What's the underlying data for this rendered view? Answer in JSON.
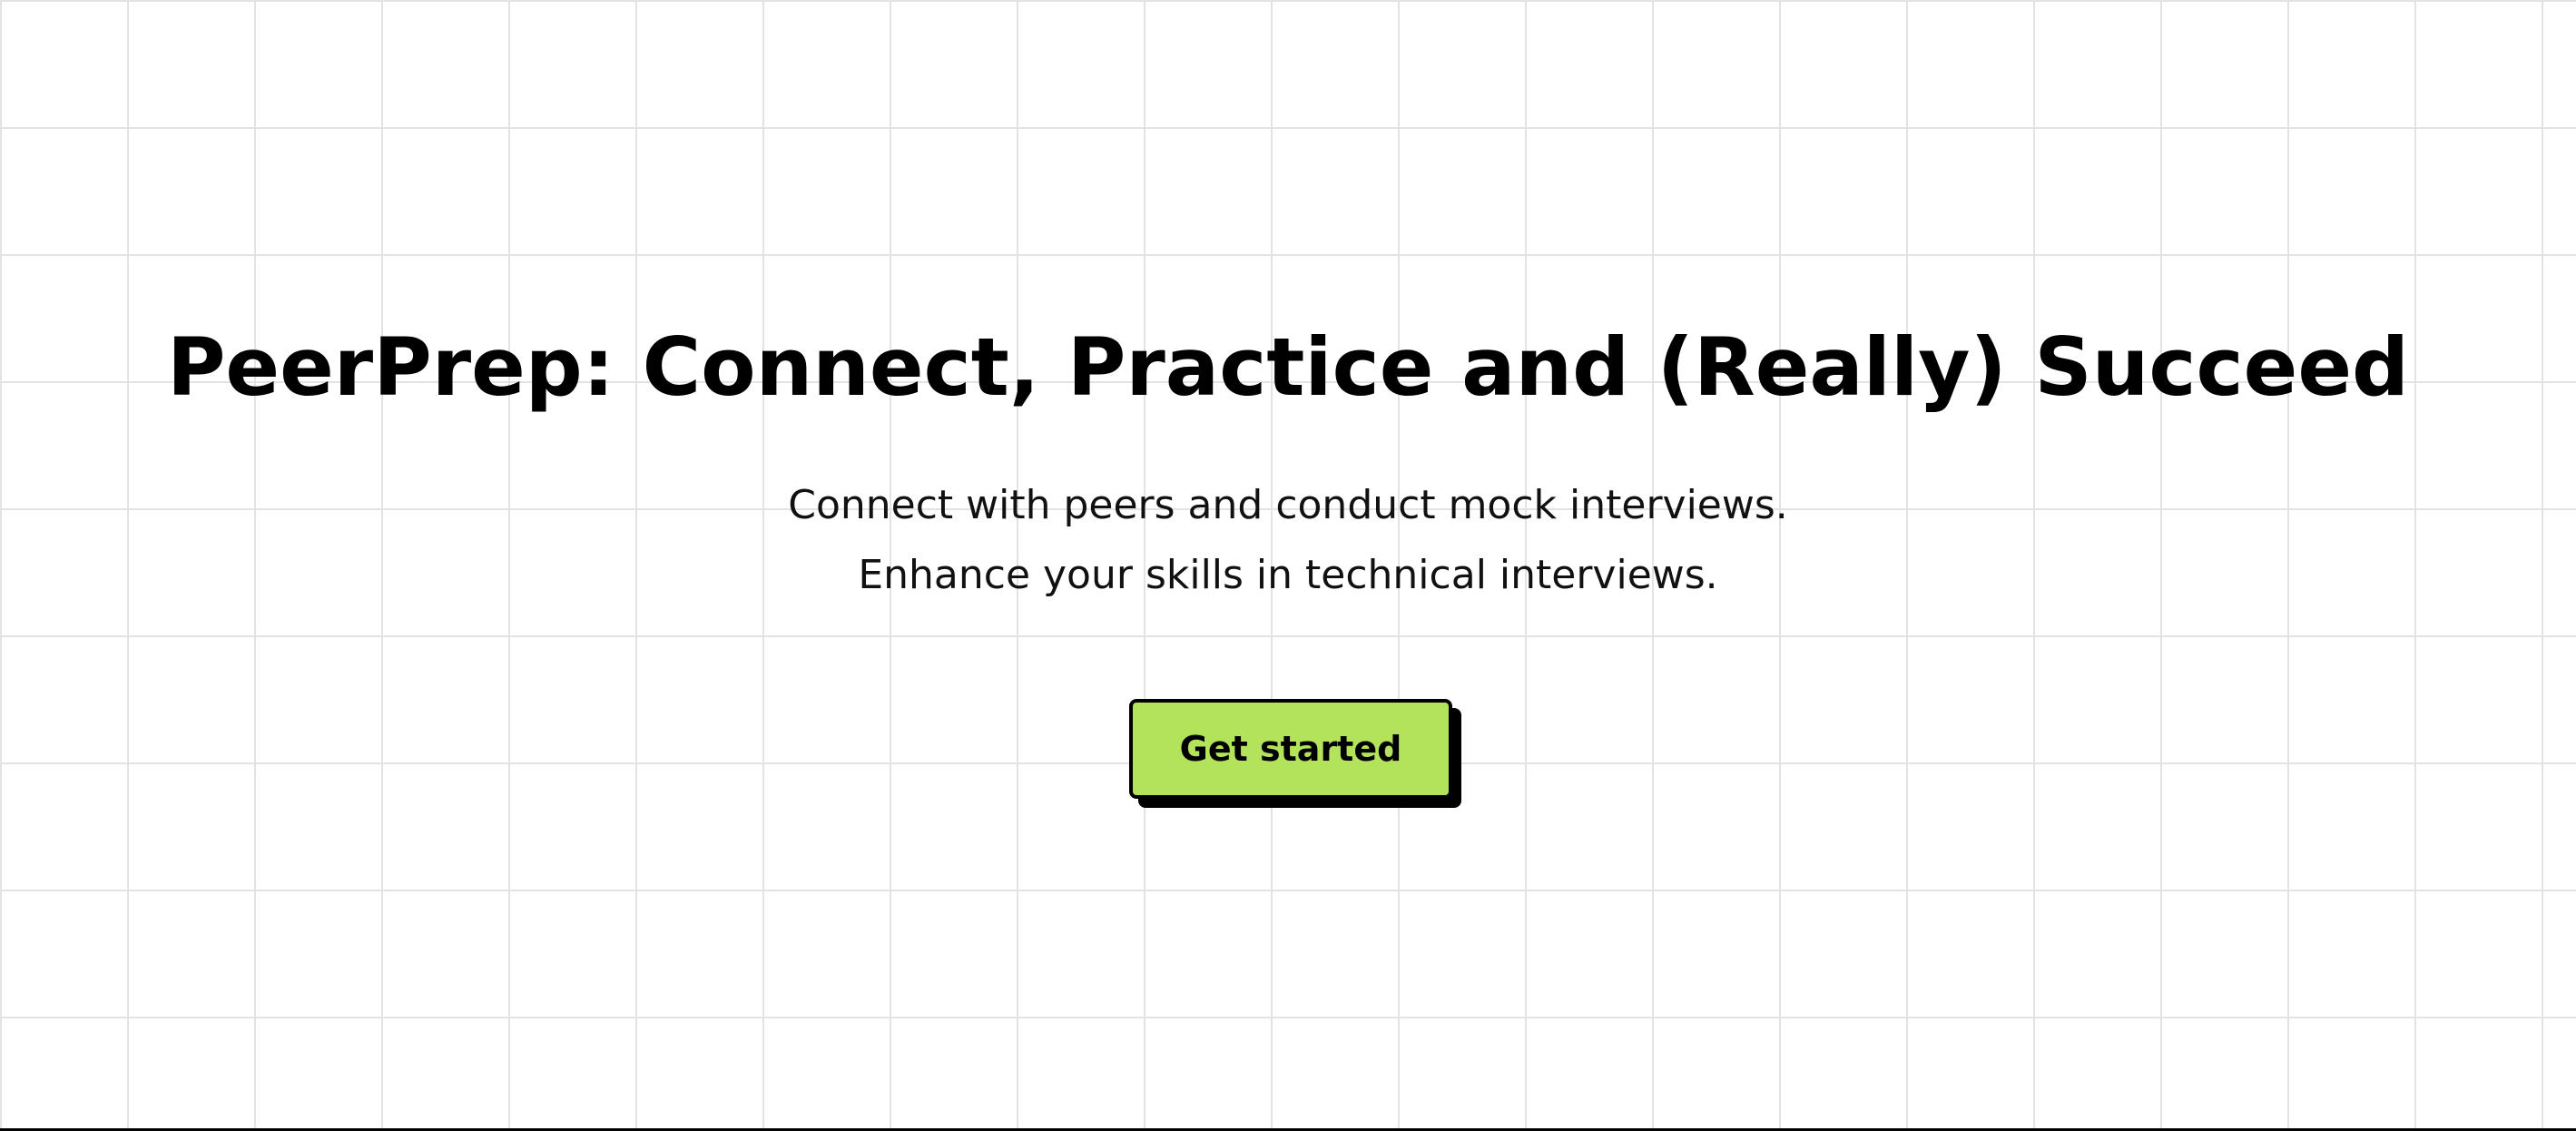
{
  "hero": {
    "title": "PeerPrep: Connect, Practice and (Really) Succeed",
    "subtitle_line1": "Connect with peers and conduct mock interviews.",
    "subtitle_line2": "Enhance your skills in technical interviews.",
    "cta_label": "Get started"
  },
  "colors": {
    "background": "#ffffff",
    "grid_line": "#e3e3e3",
    "text": "#000000",
    "cta_fill": "#b2e35a",
    "cta_border": "#000000",
    "cta_shadow": "#000000"
  }
}
